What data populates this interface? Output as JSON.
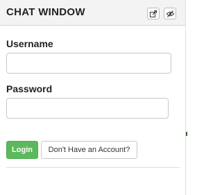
{
  "header": {
    "title": "CHAT WINDOW",
    "icons": [
      "popout-icon",
      "hide-eye-icon"
    ]
  },
  "form": {
    "username_label": "Username",
    "username_value": "",
    "username_placeholder": "",
    "password_label": "Password",
    "password_value": "",
    "password_placeholder": ""
  },
  "buttons": {
    "login_label": "Login",
    "signup_label": "Don't Have an Account?"
  },
  "colors": {
    "login_bg": "#5cb85c",
    "header_bg": "#f3f3f3"
  }
}
